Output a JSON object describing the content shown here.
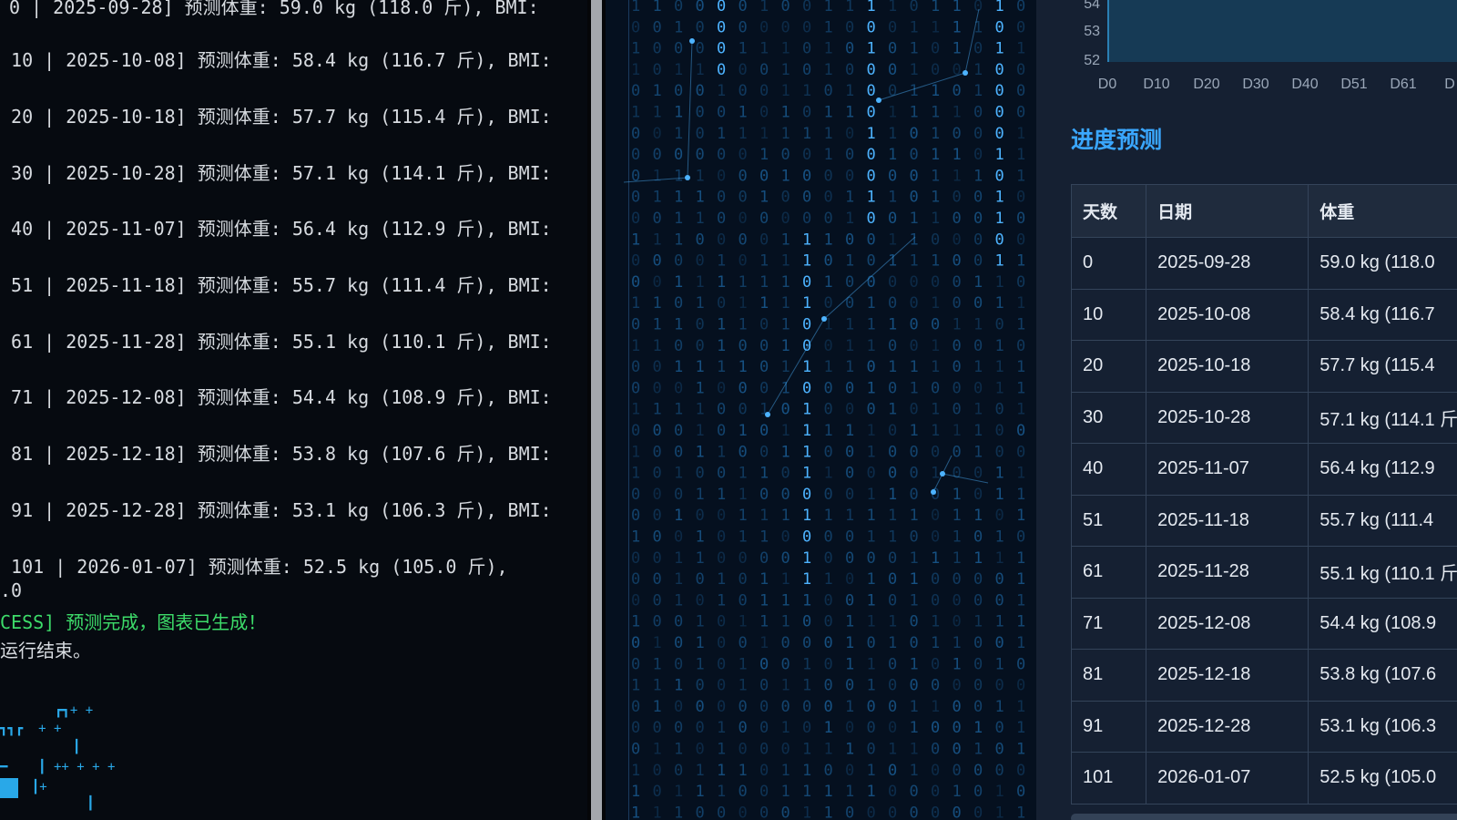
{
  "terminal": {
    "lines": [
      {
        "text": "0 | 2025-09-28] 预测体重: 59.0 kg (118.0 斤), BMI:"
      },
      {
        "text": " 10 | 2025-10-08] 预测体重: 58.4 kg (116.7 斤), BMI:"
      },
      {
        "text": " 20 | 2025-10-18] 预测体重: 57.7 kg (115.4 斤), BMI:"
      },
      {
        "text": " 30 | 2025-10-28] 预测体重: 57.1 kg (114.1 斤), BMI:"
      },
      {
        "text": " 40 | 2025-11-07] 预测体重: 56.4 kg (112.9 斤), BMI:"
      },
      {
        "text": " 51 | 2025-11-18] 预测体重: 55.7 kg (111.4 斤), BMI:"
      },
      {
        "text": " 61 | 2025-11-28] 预测体重: 55.1 kg (110.1 斤), BMI:"
      },
      {
        "text": " 71 | 2025-12-08] 预测体重: 54.4 kg (108.9 斤), BMI:"
      },
      {
        "text": " 81 | 2025-12-18] 预测体重: 53.8 kg (107.6 斤), BMI:"
      },
      {
        "text": " 91 | 2025-12-28] 预测体重: 53.1 kg (106.3 斤), BMI:"
      },
      {
        "text": " 101 | 2026-01-07] 预测体重: 52.5 kg (105.0 斤),"
      },
      {
        "text": ".0"
      },
      {
        "text": "CESS] 预测完成，图表已生成！"
      },
      {
        "text": "运行结束。"
      }
    ],
    "ascii_art": [
      "┏┓+ +",
      "┓┓┏  + +",
      "┃",
      "━    ┃ ++ + + +",
      "  ┃+",
      "   ┃"
    ],
    "success_color": "#3ddc6a",
    "text_color": "#d7dbe0"
  },
  "matrix": {
    "description_color": "#1f6fb0",
    "highlight_color": "#4db3ff"
  },
  "app": {
    "mini_chart": {
      "y_ticks": [
        "54",
        "53",
        "52"
      ],
      "x_ticks": [
        "D0",
        "D10",
        "D20",
        "D30",
        "D40",
        "D51",
        "D61",
        "D"
      ]
    },
    "section_title": "进度预测",
    "table": {
      "headers": [
        "天数",
        "日期",
        "体重"
      ],
      "rows": [
        [
          "0",
          "2025-09-28",
          "59.0 kg (118.0"
        ],
        [
          "10",
          "2025-10-08",
          "58.4 kg (116.7"
        ],
        [
          "20",
          "2025-10-18",
          "57.7 kg (115.4"
        ],
        [
          "30",
          "2025-10-28",
          "57.1 kg (114.1 斤"
        ],
        [
          "40",
          "2025-11-07",
          "56.4 kg (112.9"
        ],
        [
          "51",
          "2025-11-18",
          "55.7 kg (111.4"
        ],
        [
          "61",
          "2025-11-28",
          "55.1 kg (110.1 斤"
        ],
        [
          "71",
          "2025-12-08",
          "54.4 kg (108.9"
        ],
        [
          "81",
          "2025-12-18",
          "53.8 kg (107.6"
        ],
        [
          "91",
          "2025-12-28",
          "53.1 kg (106.3"
        ],
        [
          "101",
          "2026-01-07",
          "52.5 kg (105.0"
        ]
      ]
    },
    "accent_color": "#3aa7ff"
  }
}
